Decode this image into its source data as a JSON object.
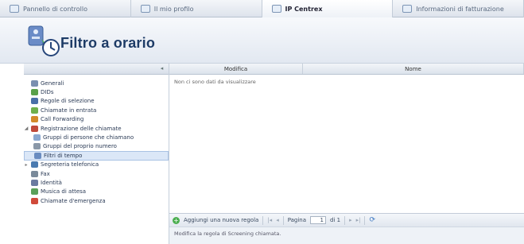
{
  "tabs": [
    {
      "label": "Pannello di controllo",
      "icon": "control-panel-icon"
    },
    {
      "label": "Il mio profilo",
      "icon": "profile-icon"
    },
    {
      "label": "IP Centrex",
      "icon": "phone-icon"
    },
    {
      "label": "Informazioni di fatturazione",
      "icon": "billing-icon"
    }
  ],
  "active_tab": 2,
  "header": {
    "title": "Filtro a orario",
    "icon": "time-filter-icon"
  },
  "sidebar": {
    "items": [
      {
        "label": "Generali",
        "icon": "general-icon",
        "color": "#7a8fb0"
      },
      {
        "label": "DIDs",
        "icon": "did-icon",
        "color": "#5aa04a"
      },
      {
        "label": "Regole di selezione",
        "icon": "rules-icon",
        "color": "#4a6fa8"
      },
      {
        "label": "Chiamate in entrata",
        "icon": "incoming-call-icon",
        "color": "#6fb04c"
      },
      {
        "label": "Call Forwarding",
        "icon": "forward-icon",
        "color": "#d38a2a"
      },
      {
        "label": "Registrazione delle chiamate",
        "icon": "recording-icon",
        "color": "#c04a3a"
      },
      {
        "label": "Gruppi di persone che chiamano",
        "icon": "caller-groups-icon",
        "color": "#8aa8d0"
      },
      {
        "label": "Gruppi del proprio numero",
        "icon": "number-groups-icon",
        "color": "#8a98a8"
      },
      {
        "label": "Filtri di tempo",
        "icon": "time-filter-icon",
        "color": "#6a8cc0"
      },
      {
        "label": "Segreteria telefonica",
        "icon": "voicemail-icon",
        "color": "#4a7ab0"
      },
      {
        "label": "Fax",
        "icon": "fax-icon",
        "color": "#7a8a9a"
      },
      {
        "label": "Identità",
        "icon": "identity-icon",
        "color": "#6a7aa0"
      },
      {
        "label": "Musica di attesa",
        "icon": "music-icon",
        "color": "#5aa05a"
      },
      {
        "label": "Chiamate d'emergenza",
        "icon": "emergency-icon",
        "color": "#d04a3a"
      }
    ],
    "selected_index": 8
  },
  "grid": {
    "columns": [
      "Modifica",
      "Nome"
    ],
    "empty_text": "Non ci sono dati da visualizzare"
  },
  "toolbar": {
    "add_label": "Aggiungi una nuova regola",
    "page_label": "Pagina",
    "page_value": "1",
    "page_of": "di 1"
  },
  "status_text": "Modifica la regola di Screening chiamata."
}
